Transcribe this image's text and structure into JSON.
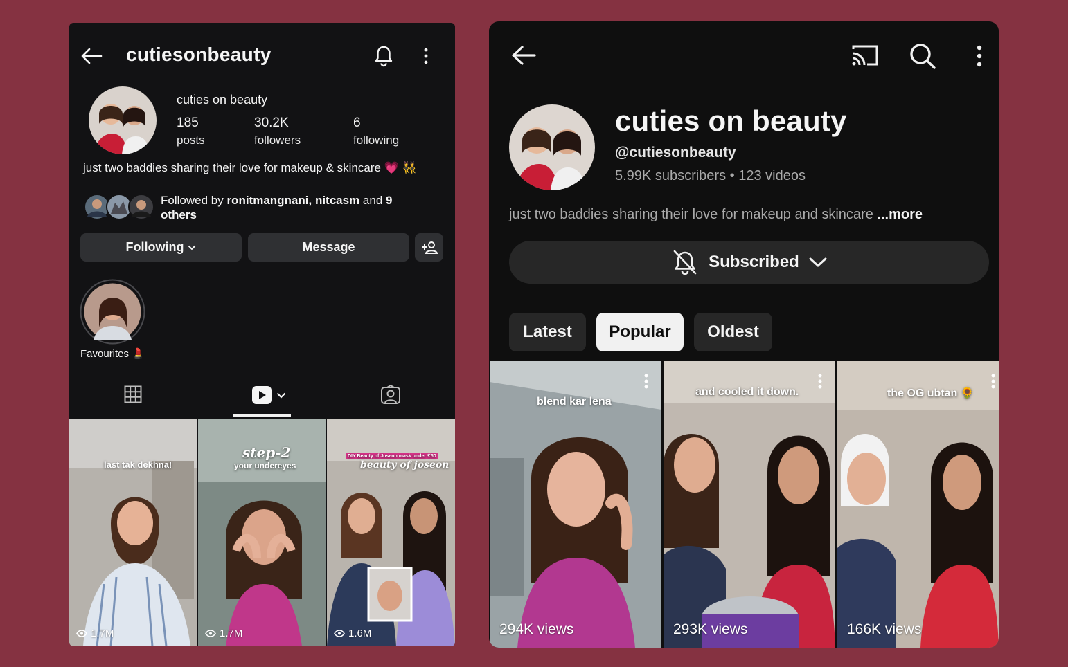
{
  "instagram": {
    "title": "cutiesonbeauty",
    "name": "cuties on beauty",
    "stats": [
      {
        "value": "185",
        "label": "posts"
      },
      {
        "value": "30.2K",
        "label": "followers"
      },
      {
        "value": "6",
        "label": "following"
      }
    ],
    "bio": "just two baddies sharing their love for makeup & skincare 💗 👯",
    "followed_prefix": "Followed by ",
    "followed_names": "ronitmangnani, nitcasm",
    "followed_mid": " and ",
    "followed_count": "9 others",
    "buttons": {
      "following": "Following",
      "message": "Message"
    },
    "highlight_label": "Favourites 💄",
    "reels": [
      {
        "caption": "last tak dekhna!",
        "views": "1.7M"
      },
      {
        "caption": "step-2",
        "subcaption": "your undereyes",
        "views": "1.7M"
      },
      {
        "caption": "DIY Beauty of Joseon mask under ₹50",
        "subcaption": "beauty of joseon",
        "views": "1.6M"
      }
    ]
  },
  "youtube": {
    "name": "cuties on beauty",
    "handle": "@cutiesonbeauty",
    "subscribers": "5.99K subscribers",
    "separator": "•",
    "videos": "123 videos",
    "bio": "just two baddies sharing their love for makeup and skincare ",
    "more": "...more",
    "subscribed_label": "Subscribed",
    "chips": [
      "Latest",
      "Popular",
      "Oldest"
    ],
    "active_chip": "Popular",
    "shorts": [
      {
        "caption": "blend kar lena",
        "views": "294K views"
      },
      {
        "caption": "and cooled it down.",
        "views": "293K views"
      },
      {
        "caption": "the OG ubtan 🌻",
        "views": "166K views"
      }
    ]
  },
  "colors": {
    "background": "#853241",
    "ig_panel": "#121214",
    "yt_panel": "#0f0f0f",
    "button": "#2f3033",
    "chip": "#272727"
  }
}
